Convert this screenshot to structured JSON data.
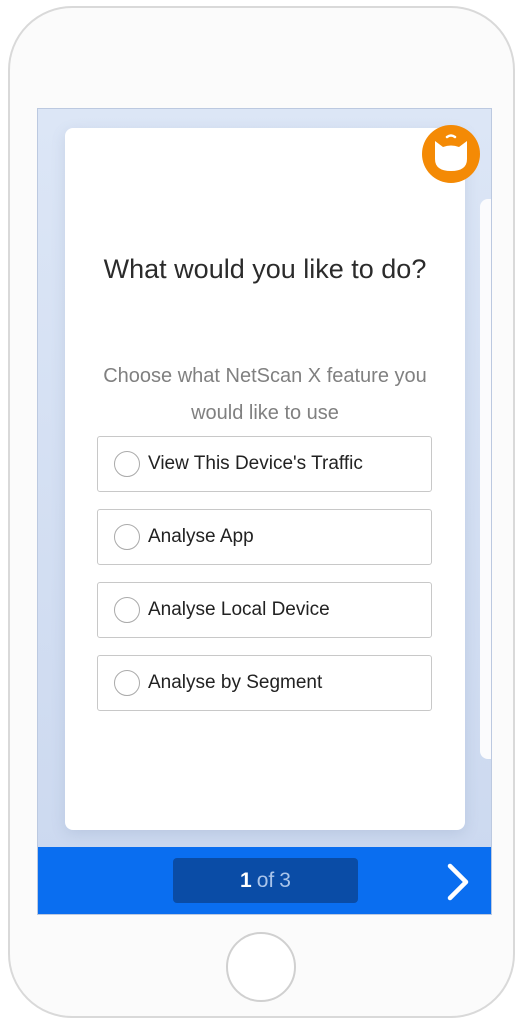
{
  "question": {
    "title": "What would you like to do?",
    "subtitle": "Choose what NetScan X feature you would like to use"
  },
  "options": [
    {
      "label": "View This Device's Traffic"
    },
    {
      "label": "Analyse App"
    },
    {
      "label": "Analyse Local Device"
    },
    {
      "label": "Analyse by Segment"
    }
  ],
  "pager": {
    "current": "1",
    "separator": "of",
    "total": "3"
  },
  "colors": {
    "accent": "#0a6ef0",
    "pager_bg": "#0a4ca6",
    "mascot": "#f48a05"
  },
  "icons": {
    "mascot": "cat-mascot-icon",
    "next": "chevron-right-icon"
  }
}
